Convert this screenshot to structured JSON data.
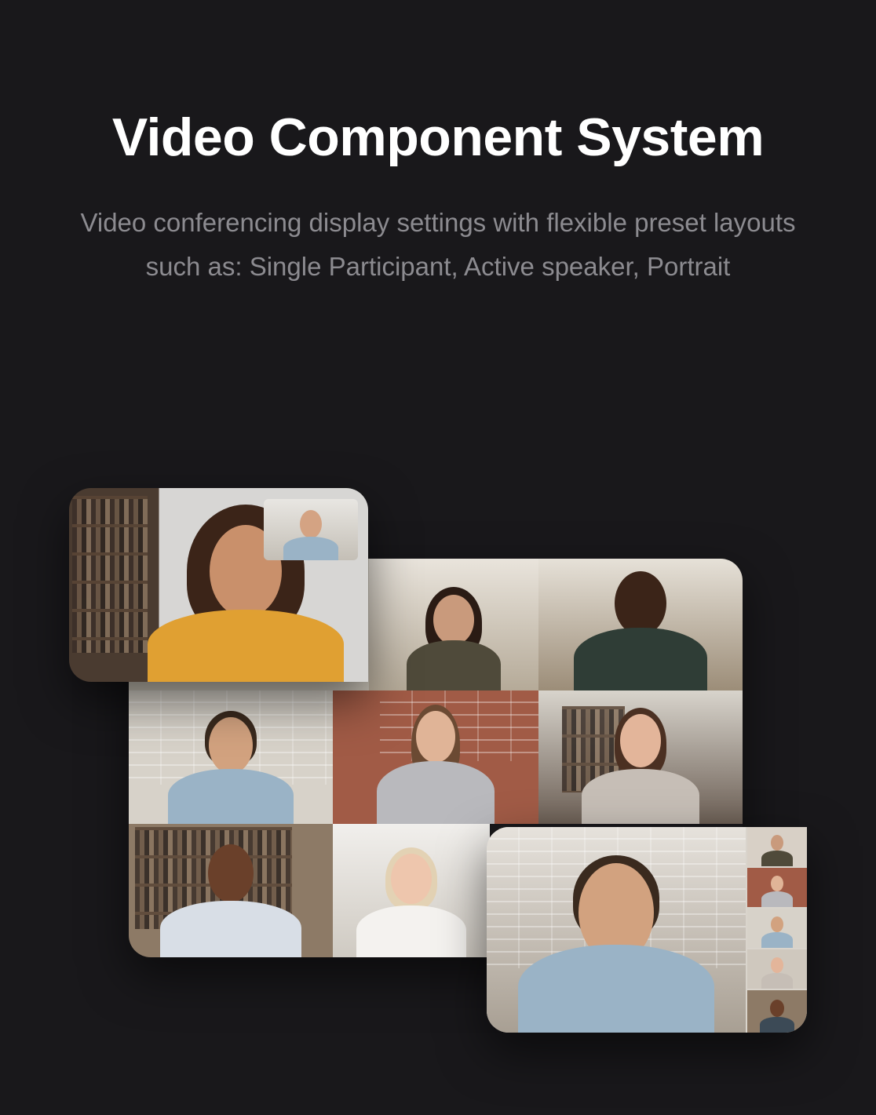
{
  "header": {
    "title": "Video Component System",
    "subtitle": "Video conferencing display settings with flexible preset layouts such as: Single Participant, Active speaker, Portrait"
  },
  "colors": {
    "background": "#19181b",
    "title": "#ffffff",
    "subtitle": "#8c8b90"
  },
  "layouts": [
    {
      "name": "single-participant",
      "participants": 2
    },
    {
      "name": "grid",
      "participants": 8
    },
    {
      "name": "active-speaker",
      "participants": 6
    }
  ]
}
